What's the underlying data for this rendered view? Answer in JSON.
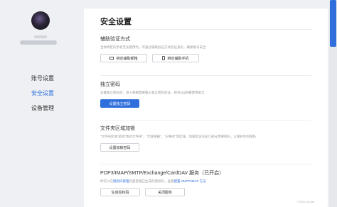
{
  "sidebar": {
    "items": [
      {
        "label": "账号设置"
      },
      {
        "label": "安全设置"
      },
      {
        "label": "设备管理"
      }
    ]
  },
  "main": {
    "title": "安全设置",
    "sections": [
      {
        "title": "辅助验证方式",
        "desc": "当你绑定的手机无法使用时，可通过辅助验证方式验证身份，确保账号安全",
        "buttons": [
          "绑定辅助邮箱",
          "绑定辅助手机"
        ]
      },
      {
        "title": "独立密码",
        "desc": "设置独立密码后，进入邮箱需要输入独立密码验证，提升QQ邮箱使用安全",
        "buttons": [
          "设置独立密码"
        ]
      },
      {
        "title": "文件夹区域加锁",
        "desc": "“文件夹区域”是指“我的文件夹”、“代收邮箱”、“记事本”等区域。加锁后访问这几部分需要密码，以保护你的隐私",
        "buttons": [
          "设置加锁密码"
        ]
      },
      {
        "title": "POP3/IMAP/SMTP/Exchange/CardDAV 服务（已开启）",
        "desc_prefix": "你可以在",
        "desc_link1": "授权码管理",
        "desc_mid": "页面管理已生成的授权码，查看",
        "desc_link2": "配置 SMTP/IMAP 方法",
        "buttons": [
          "生成授权码",
          "关闭服务"
        ]
      }
    ]
  },
  "watermark": "CSDN @Lilliu",
  "colors": {
    "accent": "#2f6fdc",
    "background": "#eef0f3",
    "panel": "#ffffff"
  }
}
